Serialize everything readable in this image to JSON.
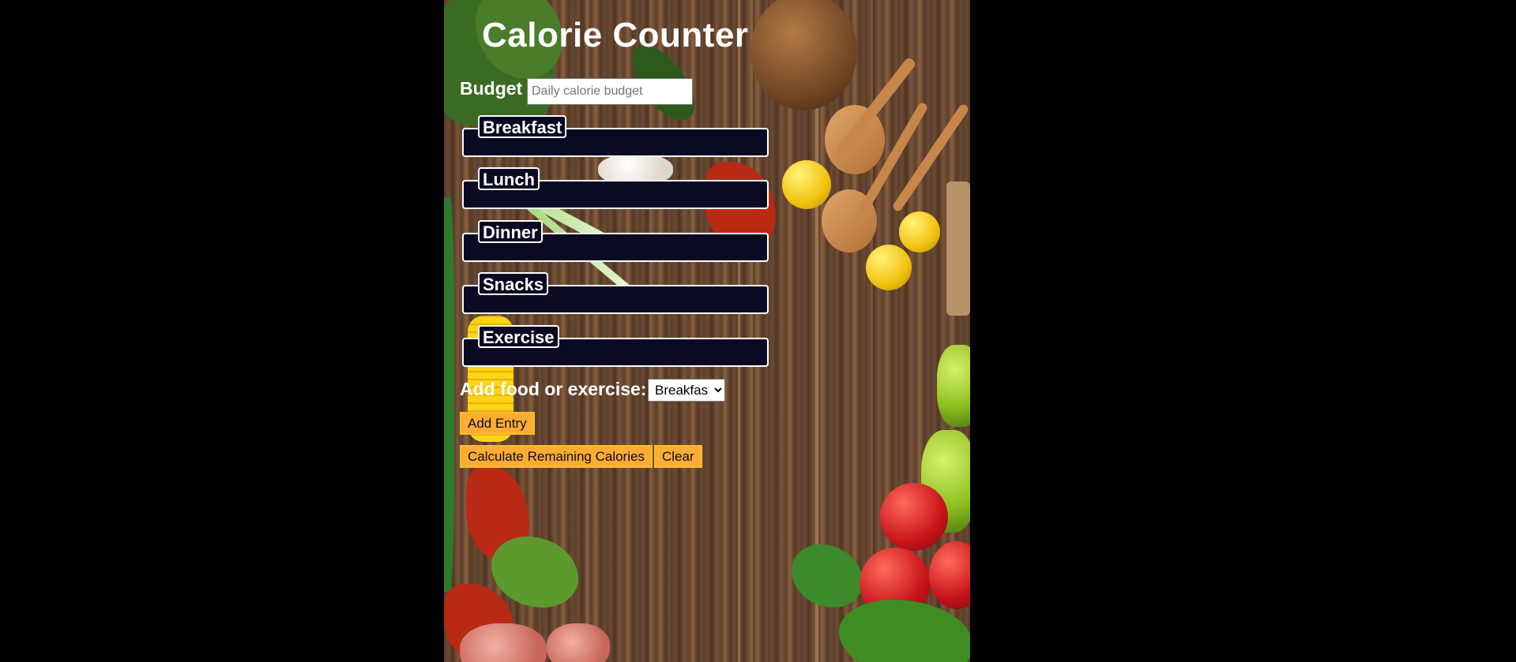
{
  "app": {
    "title": "Calorie Counter"
  },
  "budget": {
    "label": "Budget",
    "placeholder": "Daily calorie budget",
    "value": ""
  },
  "meals": [
    {
      "name": "Breakfast"
    },
    {
      "name": "Lunch"
    },
    {
      "name": "Dinner"
    },
    {
      "name": "Snacks"
    },
    {
      "name": "Exercise"
    }
  ],
  "entry": {
    "label": "Add food or exercise:",
    "selected_option": "Breakfast"
  },
  "buttons": {
    "add_entry": "Add Entry",
    "calculate": "Calculate Remaining Calories",
    "clear": "Clear"
  },
  "colors": {
    "page_background": "#000000",
    "fieldset_background": "#0a0a23",
    "button_background": "#feac32",
    "text": "#ffffff"
  },
  "icons": {
    "select_arrow": "chevron-down-icon"
  }
}
